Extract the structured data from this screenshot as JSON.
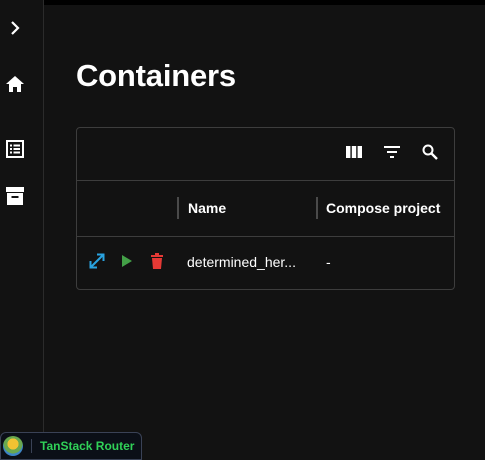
{
  "sidebar": {
    "items": [
      {
        "name": "expand",
        "icon": "chevron-right-icon"
      },
      {
        "name": "home",
        "icon": "home-icon"
      },
      {
        "name": "list",
        "icon": "list-icon"
      },
      {
        "name": "archive",
        "icon": "archive-icon"
      }
    ]
  },
  "page": {
    "title": "Containers"
  },
  "table": {
    "toolbar": [
      {
        "icon": "columns-icon"
      },
      {
        "icon": "filter-icon"
      },
      {
        "icon": "search-icon"
      }
    ],
    "columns": [
      "Name",
      "Compose project"
    ],
    "rows": [
      {
        "name": "determined_her...",
        "compose_project": "-",
        "actions": [
          "expand-icon",
          "play-icon",
          "delete-icon"
        ]
      }
    ]
  },
  "devtools": {
    "label": "TanStack Router"
  },
  "colors": {
    "background": "#121212",
    "border": "#3d3d3d",
    "expand": "#29a3e0",
    "play": "#43a047",
    "delete": "#e53935",
    "tanstack_label": "#30d158"
  }
}
